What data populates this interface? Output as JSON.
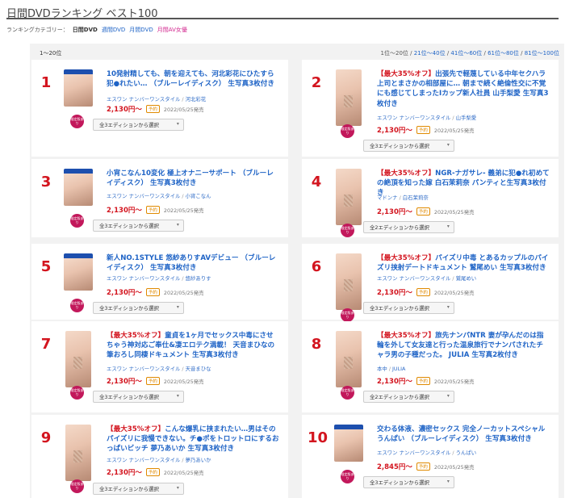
{
  "page_title": "日間DVDランキング ベスト100",
  "category_nav": {
    "label": "ランキングカテゴリー：",
    "items": [
      {
        "label": "日間DVD",
        "current": true
      },
      {
        "label": "週間DVD"
      },
      {
        "label": "月間DVD"
      },
      {
        "label": "月間AV女優"
      }
    ]
  },
  "range_label": "1〜20位",
  "pager": [
    "1位〜20位",
    "21位〜40位",
    "41位〜60位",
    "61位〜80位",
    "81位〜100位"
  ],
  "pager_sep": "/",
  "common": {
    "limited_badge": "限定版あり",
    "preorder_tag": "予約",
    "release_date": "2022/05/25発売"
  },
  "products": [
    {
      "rank": "1",
      "sale": "",
      "title": "10発射精しても、朝を迎えても、河北彩花にひたすら犯●れたい… （ブルーレイディスク） 生写真3枚付き",
      "label": "エスワン ナンバーワンスタイル",
      "actress": "河北彩花",
      "price": "2,130円〜",
      "edition": "全3エディションから選択",
      "thumb": "bd"
    },
    {
      "rank": "2",
      "sale": "【最大35%オフ】",
      "title": "出張先で軽蔑している中年セクハラ上司とまさかの相部屋に… 朝まで続く絶倫性交に不覚にも感じてしまったIカップ新人社員 山手梨愛 生写真3枚付き",
      "label": "エスワン ナンバーワンスタイル",
      "actress": "山手梨愛",
      "price": "2,130円〜",
      "edition": "全3エディションから選択",
      "thumb": "dvd"
    },
    {
      "rank": "3",
      "sale": "",
      "title": "小宵こなん10変化 極上オナニーサポート （ブルーレイディスク） 生写真3枚付き",
      "label": "エスワン ナンバーワンスタイル",
      "actress": "小宵こなん",
      "price": "2,130円〜",
      "edition": "全3エディションから選択",
      "thumb": "bd"
    },
    {
      "rank": "4",
      "sale": "【最大35%オフ】",
      "title": "NGR-ナガサレ- 義弟に犯●れ初めての絶頂を知った嫁 白石茉莉奈 パンティと生写真3枚付き",
      "label": "マドンナ",
      "actress": "白石茉莉奈",
      "price": "2,130円〜",
      "edition": "全2エディションから選択",
      "thumb": "dvd"
    },
    {
      "rank": "5",
      "sale": "",
      "title": "新人NO.1STYLE 悠紗ありすAVデビュー （ブルーレイディスク） 生写真3枚付き",
      "label": "エスワン ナンバーワンスタイル",
      "actress": "悠紗ありす",
      "price": "2,130円〜",
      "edition": "全3エディションから選択",
      "thumb": "bd"
    },
    {
      "rank": "6",
      "sale": "【最大35%オフ】",
      "title": "パイズリ中毒 とあるカップルのパイズリ挟射デートドキュメント 鷲尾めい 生写真3枚付き",
      "label": "エスワン ナンバーワンスタイル",
      "actress": "鷲尾めい",
      "price": "2,130円〜",
      "edition": "全3エディションから選択",
      "thumb": "dvd"
    },
    {
      "rank": "7",
      "sale": "【最大35%オフ】",
      "title": "童貞を1ヶ月でセックス中毒にさせちゃう神対応ご奉仕&凄エロテク満載！ 天音まひなの筆おろし同棲ドキュメント 生写真3枚付き",
      "label": "エスワン ナンバーワンスタイル",
      "actress": "天音まひな",
      "price": "2,130円〜",
      "edition": "全3エディションから選択",
      "thumb": "dvd"
    },
    {
      "rank": "8",
      "sale": "【最大35%オフ】",
      "title": "旅先ナンパNTR 妻が孕んだのは指輪を外して女友達と行った温泉旅行でナンパされたチャラ男の子種だった。 JULIA 生写真2枚付き",
      "label": "本中",
      "actress": "JULIA",
      "price": "2,130円〜",
      "edition": "全2エディションから選択",
      "thumb": "dvd"
    },
    {
      "rank": "9",
      "sale": "【最大35%オフ】",
      "title": "こんな爆乳に挟まれたい…男はそのパイズリに我慢できない。チ●ポをトロットロにするおっぱいビッチ 夢乃あいか 生写真3枚付き",
      "label": "エスワン ナンバーワンスタイル",
      "actress": "夢乃あいか",
      "price": "2,130円〜",
      "edition": "全3エディションから選択",
      "thumb": "dvd"
    },
    {
      "rank": "10",
      "sale": "",
      "title": "交わる体液、濃密セックス 完全ノーカットスペシャル うんぱい （ブルーレイディスク） 生写真3枚付き",
      "label": "エスワン ナンバーワンスタイル",
      "actress": "うんぱい",
      "price": "2,845円〜",
      "edition": "全3エディションから選択",
      "thumb": "bd"
    }
  ],
  "icons": {
    "chevron": "chevron-down-icon",
    "blu_ray_bar": "blu-ray-strip"
  }
}
